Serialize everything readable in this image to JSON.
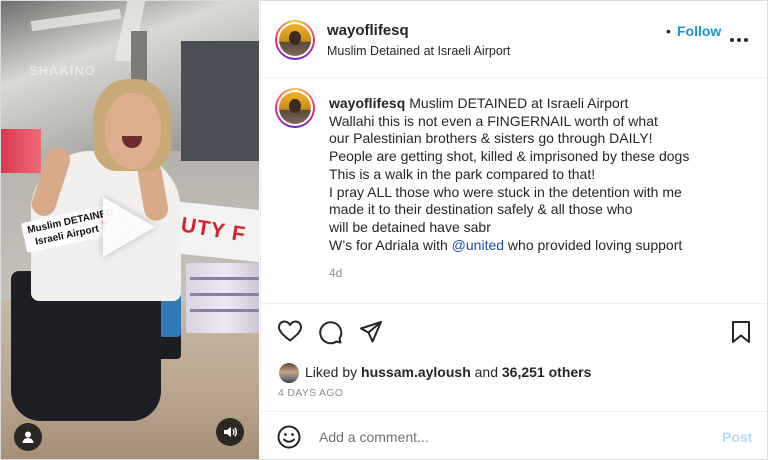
{
  "media": {
    "watermark": "SHAKINO",
    "sticker_line1": "Muslim DETAINED",
    "sticker_line2": "Israeli Airport❗️",
    "sign_text": "DUTY F"
  },
  "header": {
    "username": "wayoflifesq",
    "separator": "•",
    "follow_label": "Follow",
    "location": "Muslim Detained at Israeli Airport"
  },
  "caption": {
    "username": "wayoflifesq",
    "lines": [
      "Muslim DETAINED at Israeli Airport",
      "Wallahi this is not even a FINGERNAIL worth of what",
      "our Palestinian brothers & sisters go through DAILY!",
      "People are getting shot, killed & imprisoned by these dogs",
      "This is a walk in the park compared to that!",
      "I pray ALL those who were stuck in the detention with me",
      "made it to their destination safely & all those who",
      "will be detained have sabr"
    ],
    "last_line_prefix": "W’s for Adriala with ",
    "mention": "@united",
    "last_line_suffix": " who provided loving support",
    "time_ago": "4d"
  },
  "actions": {
    "liked_by_prefix": "Liked by ",
    "liked_by_user": "hussam.ayloush",
    "liked_by_middle": " and ",
    "others_count": "36,251 others",
    "posted": "4 DAYS AGO"
  },
  "comment": {
    "placeholder": "Add a comment...",
    "post_label": "Post"
  },
  "colors": {
    "follow": "#1796d6",
    "post_disabled": "#b3dbf7",
    "mention": "#1a4fa0"
  }
}
